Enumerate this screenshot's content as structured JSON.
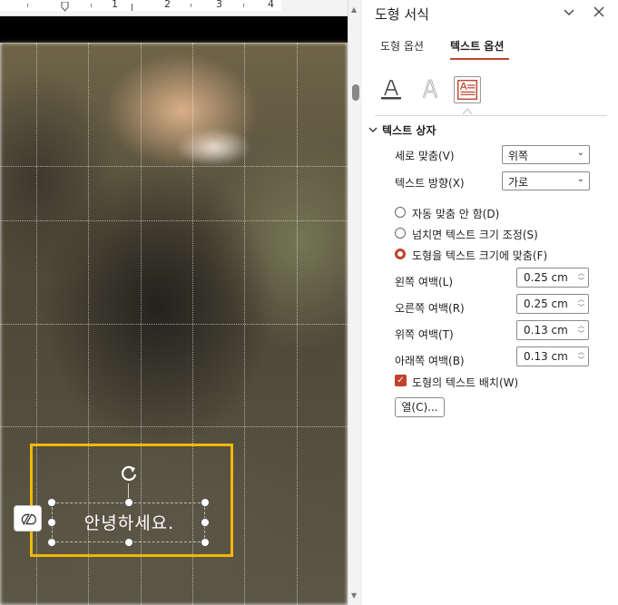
{
  "ruler": {
    "numbers": [
      "1",
      "2",
      "3",
      "4"
    ]
  },
  "slide": {
    "textbox_text": "안녕하세요."
  },
  "pane": {
    "title": "도형 서식",
    "tabs": [
      {
        "label": "도형 옵션",
        "active": false
      },
      {
        "label": "텍스트 옵션",
        "active": true
      }
    ],
    "icons": [
      "text-fill-outline-icon",
      "text-effects-icon",
      "textbox-icon"
    ],
    "section": "텍스트 상자",
    "vertical_align": {
      "label": "세로 맞춤(V)",
      "value": "위쪽"
    },
    "text_direction": {
      "label": "텍스트 방향(X)",
      "value": "가로"
    },
    "autofit": [
      {
        "label": "자동 맞춤 안 함(D)",
        "checked": false
      },
      {
        "label": "넘치면 텍스트 크기 조정(S)",
        "checked": false
      },
      {
        "label": "도형을 텍스트 크기에 맞춤(F)",
        "checked": true
      }
    ],
    "margins": [
      {
        "label": "왼쪽 여백(L)",
        "value": "0.25 cm"
      },
      {
        "label": "오른쪽 여백(R)",
        "value": "0.25 cm"
      },
      {
        "label": "위쪽 여백(T)",
        "value": "0.13 cm"
      },
      {
        "label": "아래쪽 여백(B)",
        "value": "0.13 cm"
      }
    ],
    "wrap_text": {
      "label": "도형의 텍스트 배치(W)",
      "checked": true
    },
    "columns_button": "열(C)..."
  },
  "colors": {
    "accent": "#c0432d",
    "selection": "#f5b700"
  }
}
